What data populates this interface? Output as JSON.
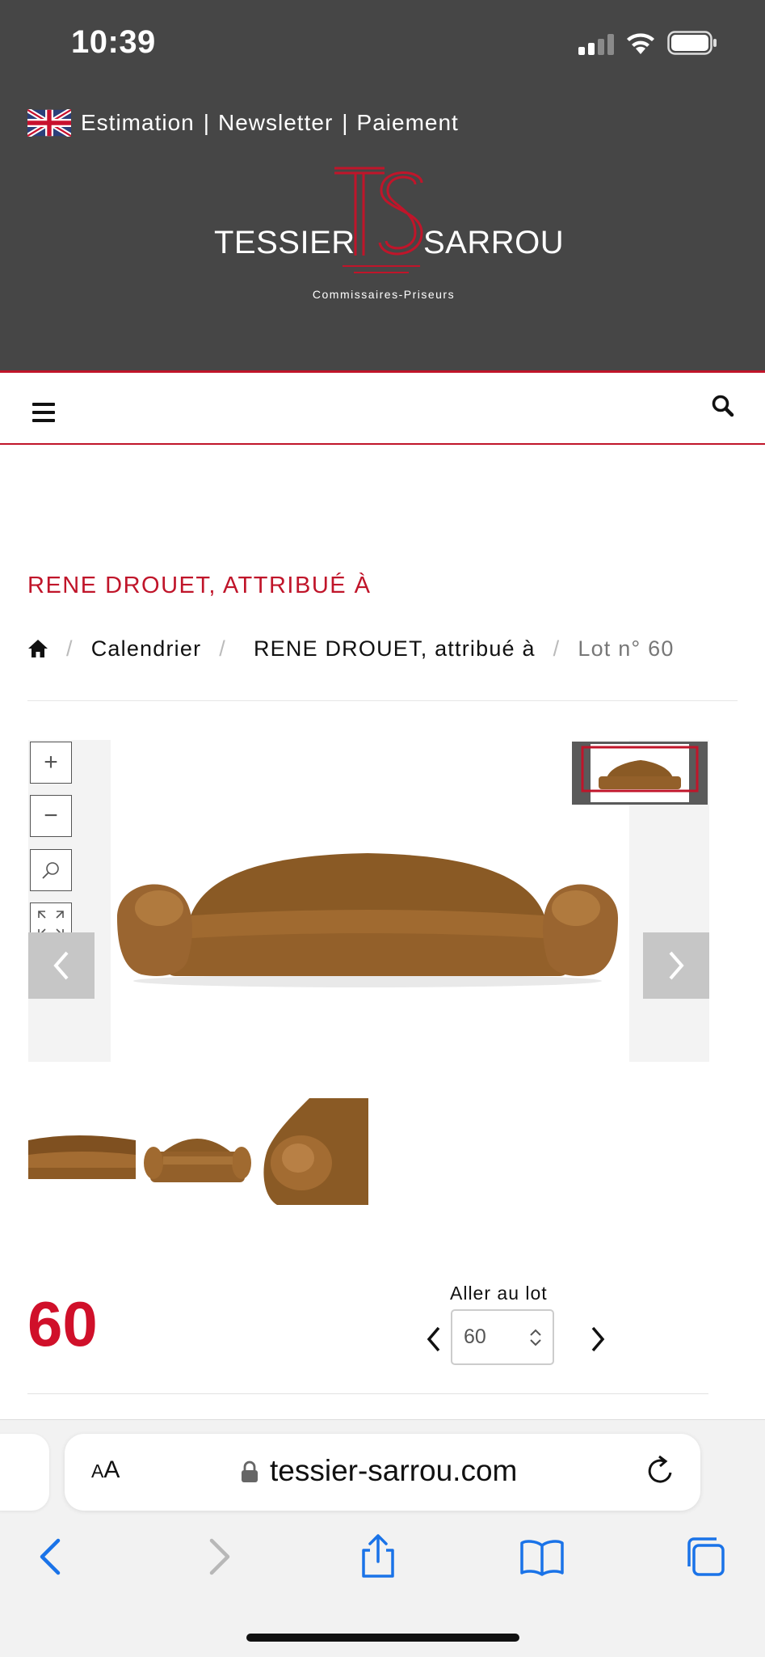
{
  "status_bar": {
    "time": "10:39"
  },
  "header": {
    "top_links": [
      "Estimation",
      "Newsletter",
      "Paiement"
    ],
    "separator": "|",
    "logo": {
      "left": "TESSIER",
      "right": "SARROU",
      "tagline": "Commissaires-Priseurs"
    }
  },
  "page": {
    "title": "RENE DROUET, ATTRIBUÉ À",
    "breadcrumb": [
      "Calendrier",
      "RENE DROUET, attribué à",
      "Lot n° 60"
    ],
    "breadcrumb_separator": "/"
  },
  "lot": {
    "number": "60",
    "goto_label": "Aller au lot",
    "goto_value": "60"
  },
  "browser": {
    "text_size_label_small": "A",
    "text_size_label_big": "A",
    "url": "tessier-sarrou.com"
  },
  "colors": {
    "header_bg": "#464646",
    "accent_red": "#c0152a",
    "lot_red": "#d0102a",
    "ios_blue": "#1a73e8"
  },
  "icons": [
    "uk-flag-icon",
    "menu-icon",
    "search-icon",
    "home-icon",
    "zoom-in-icon",
    "zoom-out-icon",
    "magnifier-icon",
    "fullscreen-icon",
    "chevron-left-icon",
    "chevron-right-icon",
    "lock-icon",
    "reload-icon",
    "back-icon",
    "forward-icon",
    "share-icon",
    "bookmarks-icon",
    "tabs-icon"
  ]
}
